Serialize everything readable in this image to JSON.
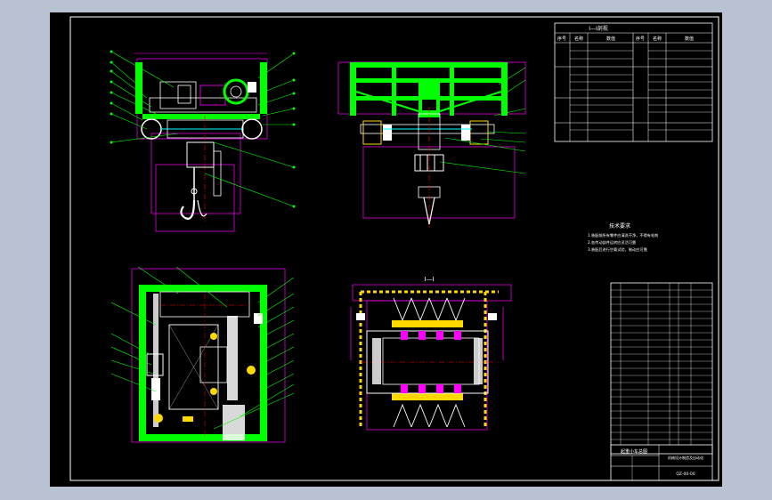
{
  "colors": {
    "background": "#b9c2d3",
    "paper": "#000000",
    "frame": "#ffffff",
    "structure": "#00ff00",
    "dimension": "#ff00ff",
    "centerline": "#ff0000",
    "detail": "#ffffff",
    "hatch": "#ffd800",
    "leader": "#00ff00"
  },
  "tech_table": {
    "title": "Ⅰ—Ⅰ剖视",
    "col_headers": [
      "序号",
      "名称",
      "数值",
      "序号",
      "名称",
      "数值"
    ]
  },
  "section_view": {
    "label": "Ⅰ—Ⅰ"
  },
  "notes": {
    "heading": "技术要求",
    "lines": [
      "1.装配前所有零件应清洗干净，不得有毛刺",
      "2.各传动部件运转应灵活可靠",
      "3.装配后进行空载试验，制动应可靠"
    ]
  },
  "title_block": {
    "name": "起重小车总图",
    "company": "机械设计制造及自动化",
    "drawing_no": "QZ-00-00"
  }
}
